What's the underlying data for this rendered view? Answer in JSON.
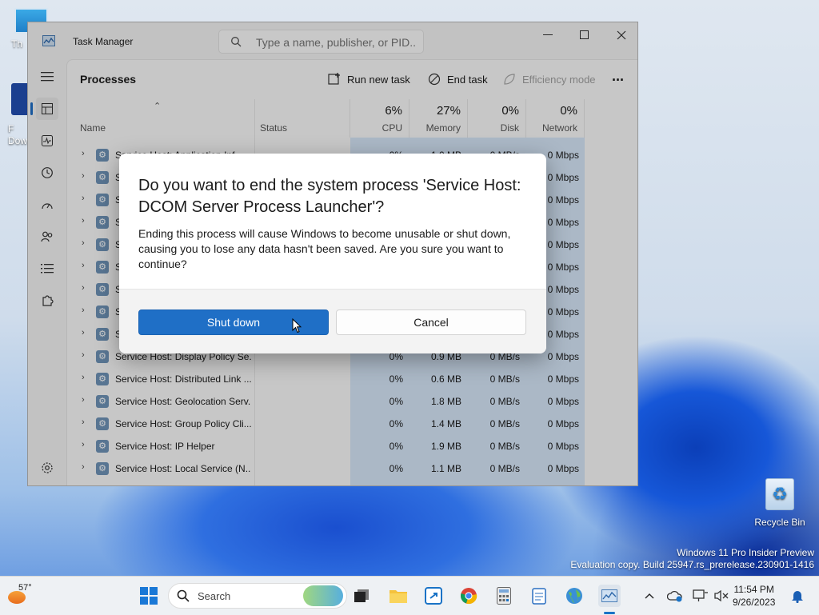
{
  "desktop": {
    "icons": [
      {
        "label": "Th",
        "name": "this-pc"
      },
      {
        "label": "F\nDow",
        "name": "downloads-shortcut"
      },
      {
        "label": "Recycle Bin",
        "name": "recycle-bin"
      }
    ],
    "watermark": {
      "line1": "Windows 11 Pro Insider Preview",
      "line2": "Evaluation copy. Build 25947.rs_prerelease.230901-1416"
    }
  },
  "task_manager": {
    "title": "Task Manager",
    "search_placeholder": "Type a name, publisher, or PID...",
    "page_title": "Processes",
    "toolbar": {
      "run_new_task": "Run new task",
      "end_task": "End task",
      "efficiency_mode": "Efficiency mode",
      "more": "..."
    },
    "columns": {
      "name": "Name",
      "status": "Status",
      "cpu_pct": "6%",
      "cpu": "CPU",
      "memory_pct": "27%",
      "memory": "Memory",
      "disk_pct": "0%",
      "disk": "Disk",
      "network_pct": "0%",
      "network": "Network"
    },
    "rows": [
      {
        "name": "Service Host: Application Inf",
        "cpu": "0%",
        "mem": "1.0 MB",
        "disk": "0 MB/s",
        "net": "0 Mbps"
      },
      {
        "name": "S",
        "cpu": "",
        "mem": "",
        "disk": "",
        "net": "0 Mbps"
      },
      {
        "name": "S",
        "cpu": "",
        "mem": "",
        "disk": "",
        "net": "0 Mbps"
      },
      {
        "name": "S",
        "cpu": "",
        "mem": "",
        "disk": "",
        "net": "0 Mbps"
      },
      {
        "name": "S",
        "cpu": "",
        "mem": "",
        "disk": "",
        "net": "0 Mbps"
      },
      {
        "name": "S",
        "cpu": "",
        "mem": "",
        "disk": "",
        "net": "0 Mbps"
      },
      {
        "name": "S",
        "cpu": "",
        "mem": "",
        "disk": "",
        "net": "0 Mbps"
      },
      {
        "name": "S",
        "cpu": "",
        "mem": "",
        "disk": "",
        "net": "0 Mbps"
      },
      {
        "name": "S",
        "cpu": "",
        "mem": "",
        "disk": "",
        "net": "0 Mbps"
      },
      {
        "name": "Service Host: Display Policy Se...",
        "cpu": "0%",
        "mem": "0.9 MB",
        "disk": "0 MB/s",
        "net": "0 Mbps"
      },
      {
        "name": "Service Host: Distributed Link ...",
        "cpu": "0%",
        "mem": "0.6 MB",
        "disk": "0 MB/s",
        "net": "0 Mbps"
      },
      {
        "name": "Service Host: Geolocation Serv...",
        "cpu": "0%",
        "mem": "1.8 MB",
        "disk": "0 MB/s",
        "net": "0 Mbps"
      },
      {
        "name": "Service Host: Group Policy Cli...",
        "cpu": "0%",
        "mem": "1.4 MB",
        "disk": "0 MB/s",
        "net": "0 Mbps"
      },
      {
        "name": "Service Host: IP Helper",
        "cpu": "0%",
        "mem": "1.9 MB",
        "disk": "0 MB/s",
        "net": "0 Mbps"
      },
      {
        "name": "Service Host: Local Service (N...",
        "cpu": "0%",
        "mem": "1.1 MB",
        "disk": "0 MB/s",
        "net": "0 Mbps"
      }
    ]
  },
  "dialog": {
    "title": "Do you want to end the system process 'Service Host: DCOM Server Process Launcher'?",
    "body": "Ending this process will cause Windows to become unusable or shut down, causing you to lose any data hasn't been saved. Are you sure you want to continue?",
    "primary_button": "Shut down",
    "secondary_button": "Cancel"
  },
  "taskbar": {
    "weather_temp": "57°",
    "search_label": "Search",
    "time": "11:54 PM",
    "date": "9/26/2023"
  },
  "colors": {
    "accent": "#1f6fc6",
    "highlight_column": "#d6e6f8"
  }
}
